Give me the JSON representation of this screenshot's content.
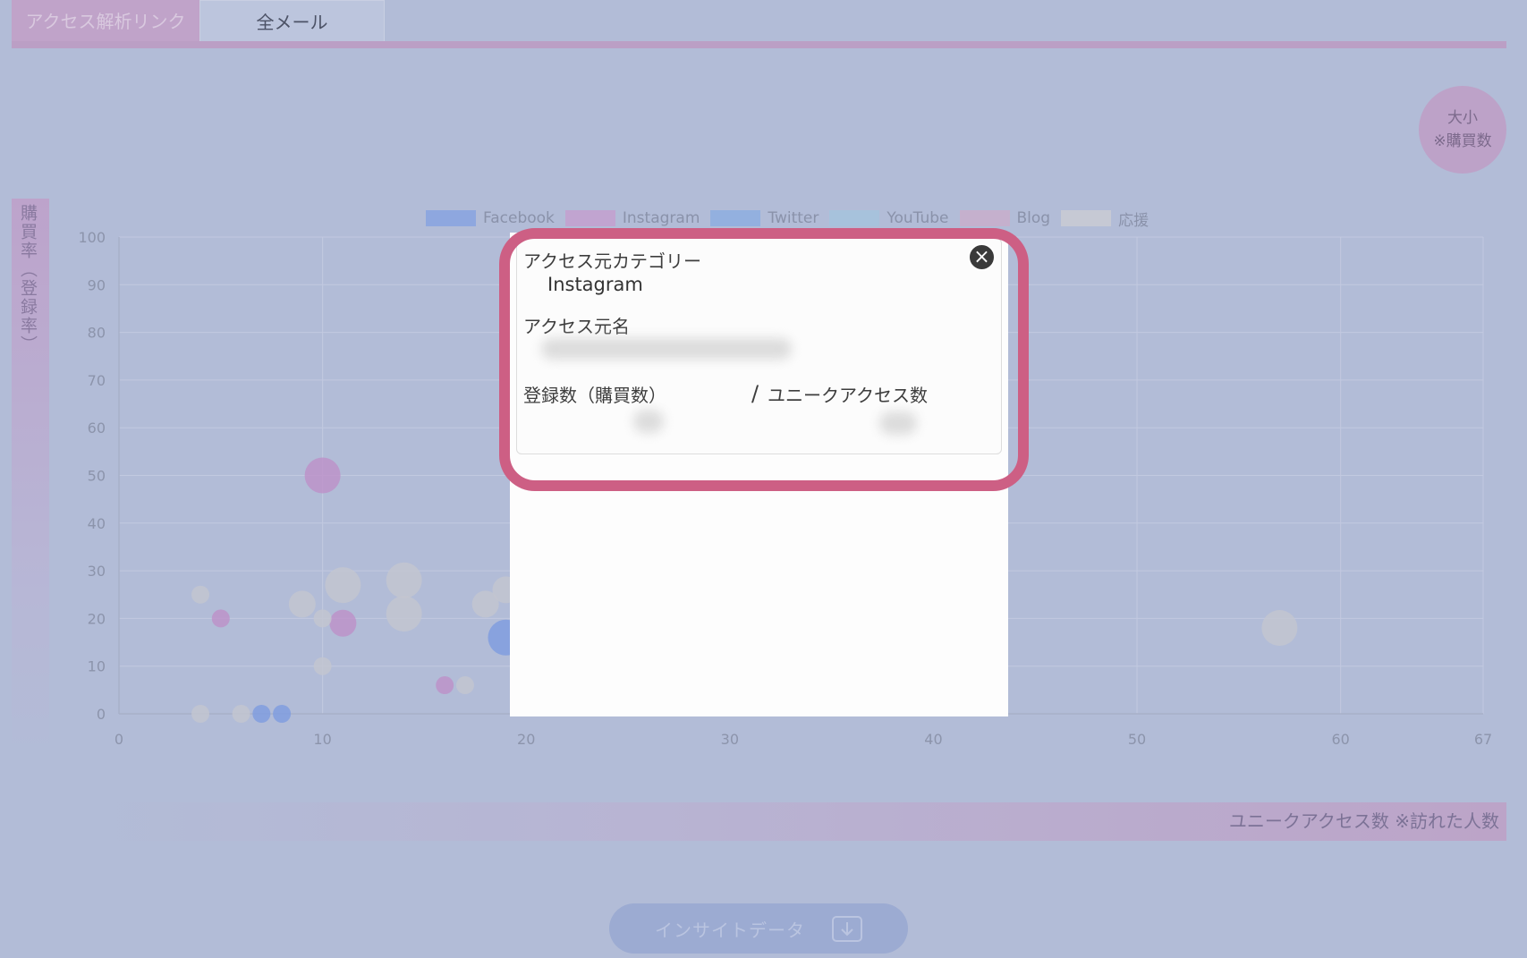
{
  "tabs": {
    "active_label": "アクセス解析リンク",
    "mail_label": "全メール"
  },
  "size_legend": {
    "line1": "大小",
    "line2": "※購買数"
  },
  "y_axis_label": "購買率（登録率）",
  "x_axis_label": "ユニークアクセス数 ※訪れた人数",
  "insight_button": {
    "label": "インサイトデータ"
  },
  "legend": [
    {
      "name": "Facebook",
      "color": "#8ea7df"
    },
    {
      "name": "Instagram",
      "color": "#c1a4d0"
    },
    {
      "name": "Twitter",
      "color": "#93b0df"
    },
    {
      "name": "YouTube",
      "color": "#a7c2dc"
    },
    {
      "name": "Blog",
      "color": "#c5b0cd"
    },
    {
      "name": "応援",
      "color": "#c6c9d4"
    }
  ],
  "modal": {
    "category_label": "アクセス元カテゴリー",
    "category_value": "Instagram",
    "name_label": "アクセス元名",
    "registrations_label": "登録数（購買数）",
    "slash": "/",
    "unique_access_label": "ユニークアクセス数",
    "close_symbol": "×"
  },
  "chart_data": {
    "type": "scatter",
    "xlim": [
      0,
      67
    ],
    "ylim": [
      0,
      100
    ],
    "x_ticks": [
      "0",
      "10",
      "20",
      "30",
      "40",
      "50",
      "60",
      "67"
    ],
    "y_ticks": [
      "0",
      "10",
      "20",
      "30",
      "40",
      "50",
      "60",
      "70",
      "80",
      "90",
      "100"
    ],
    "series": [
      {
        "name": "Facebook",
        "color": "#7d9be0",
        "points": [
          {
            "x": 7,
            "y": 0,
            "r": 1
          },
          {
            "x": 8,
            "y": 0,
            "r": 1
          },
          {
            "x": 19,
            "y": 16,
            "r": 2
          }
        ]
      },
      {
        "name": "Instagram",
        "color": "#bd90c8",
        "points": [
          {
            "x": 10,
            "y": 50,
            "r": 2
          },
          {
            "x": 5,
            "y": 20,
            "r": 1
          },
          {
            "x": 11,
            "y": 19,
            "r": 1.5
          },
          {
            "x": 16,
            "y": 6,
            "r": 1
          }
        ]
      },
      {
        "name": "応援",
        "color": "#c3c5cf",
        "points": [
          {
            "x": 4,
            "y": 25,
            "r": 1
          },
          {
            "x": 9,
            "y": 23,
            "r": 1.5
          },
          {
            "x": 10,
            "y": 20,
            "r": 1
          },
          {
            "x": 11,
            "y": 27,
            "r": 2
          },
          {
            "x": 14,
            "y": 28,
            "r": 2
          },
          {
            "x": 14,
            "y": 21,
            "r": 2
          },
          {
            "x": 18,
            "y": 23,
            "r": 1.5
          },
          {
            "x": 19,
            "y": 26,
            "r": 1.5
          },
          {
            "x": 10,
            "y": 10,
            "r": 1
          },
          {
            "x": 17,
            "y": 6,
            "r": 1
          },
          {
            "x": 4,
            "y": 0,
            "r": 1
          },
          {
            "x": 6,
            "y": 0,
            "r": 1
          },
          {
            "x": 57,
            "y": 18,
            "r": 2
          }
        ]
      }
    ]
  }
}
